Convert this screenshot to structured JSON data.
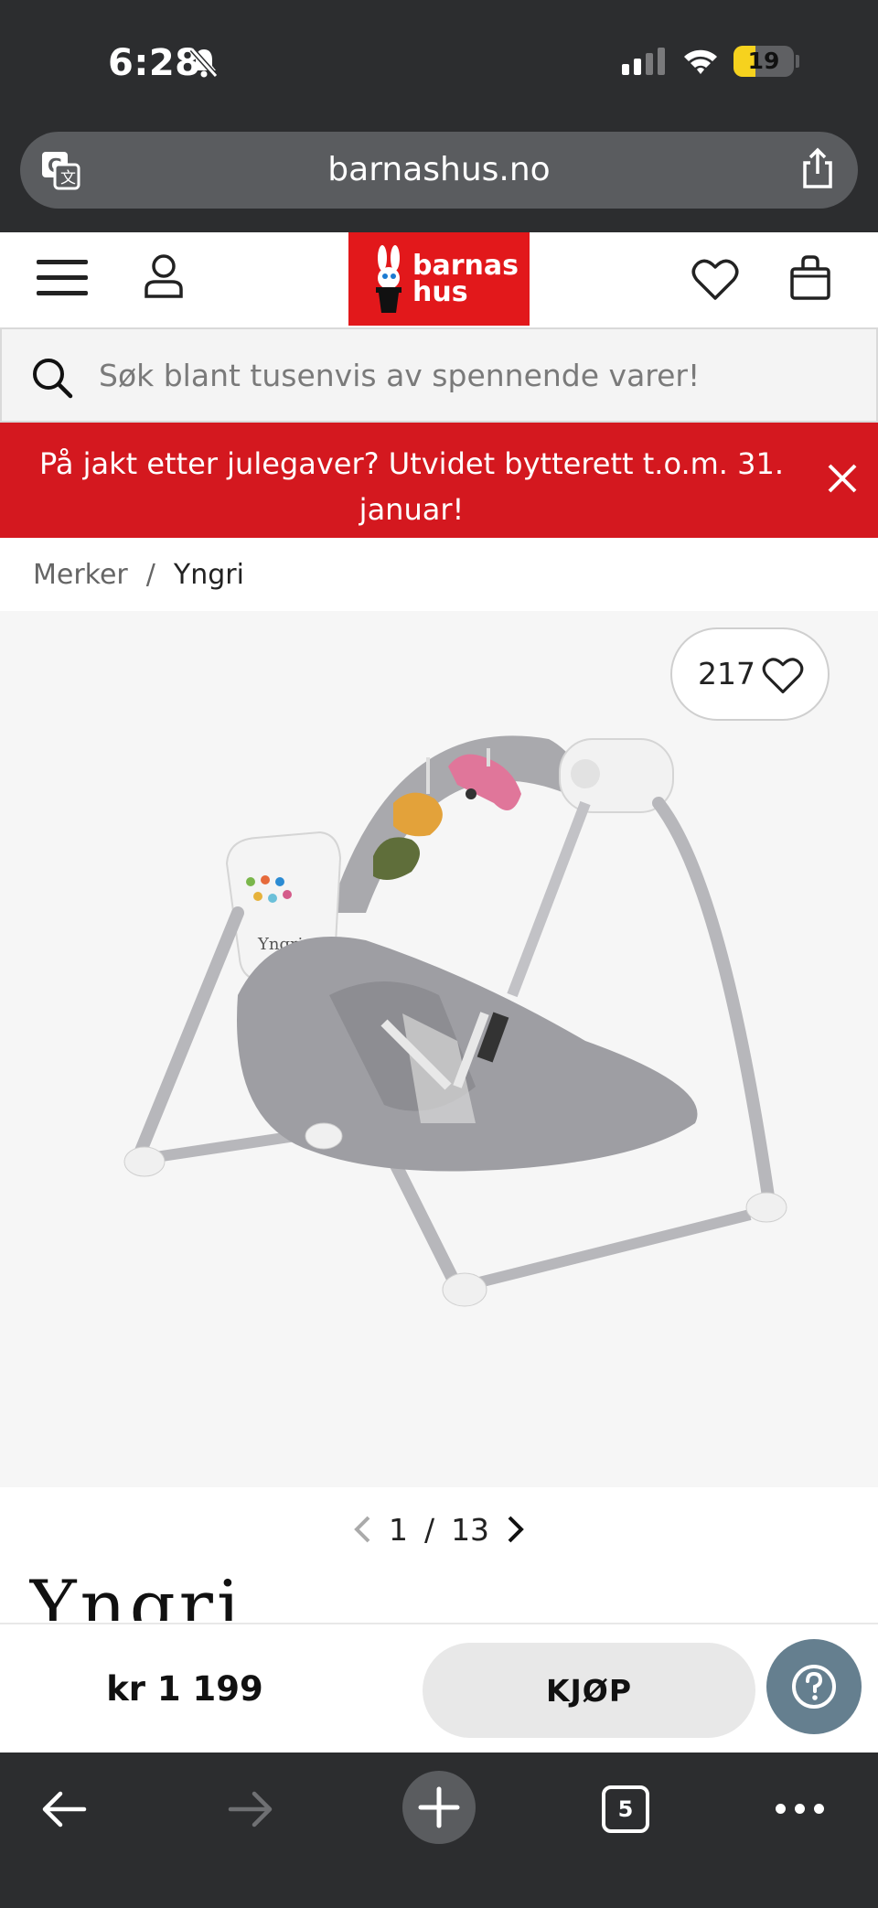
{
  "status_bar": {
    "time": "6:28",
    "battery": "19",
    "battery_level_percent": 19
  },
  "browser": {
    "url": "barnashus.no",
    "open_tabs": "5"
  },
  "header": {
    "logo_line1": "barnas",
    "logo_line2": "hus"
  },
  "search": {
    "placeholder": "Søk blant tusenvis av spennende varer!"
  },
  "banner": {
    "text": "På jakt etter julegaver? Utvidet bytterett t.o.m. 31. januar!"
  },
  "breadcrumb": {
    "items": [
      "Merker",
      "Yngri"
    ],
    "separator": "/"
  },
  "product": {
    "wishlist_count": "217",
    "image_index": "1",
    "image_separator": "/",
    "image_total": "13",
    "brand_logo": "Yngri",
    "price": "kr 1 199",
    "buy_label": "KJØP"
  },
  "colors": {
    "brand_red": "#e2181b",
    "banner_red": "#d4181f",
    "help_button": "#657f8f",
    "browser_chrome": "#2c2d2f"
  },
  "icons": [
    "translate-icon",
    "share-icon",
    "menu-icon",
    "user-icon",
    "heart-icon",
    "bag-icon",
    "search-icon",
    "close-icon",
    "chevron-left-icon",
    "chevron-right-icon",
    "help-icon",
    "back-arrow-icon",
    "forward-arrow-icon",
    "plus-icon",
    "tabs-icon",
    "more-icon"
  ]
}
